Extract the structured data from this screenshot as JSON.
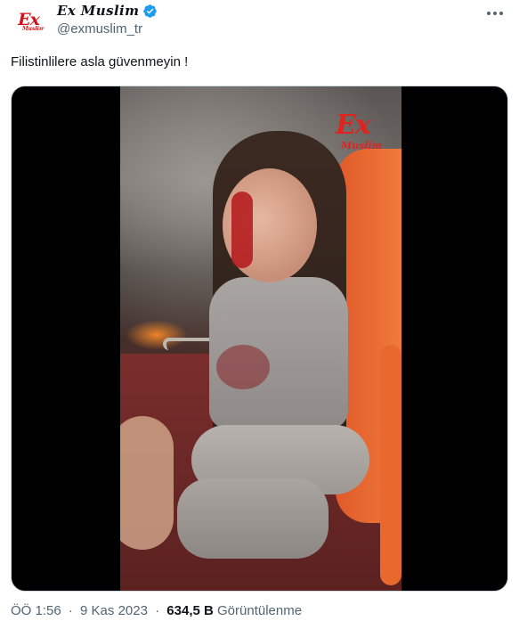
{
  "author": {
    "display_name": "Ex Muslim",
    "handle": "@exmuslim_tr",
    "avatar_logo_text": "Ex",
    "avatar_logo_sub": "Muslim",
    "verified": true
  },
  "tweet": {
    "text": "Filistinlilere asla güvenmeyin !"
  },
  "media": {
    "type": "video",
    "watermark_ex": "Ex",
    "watermark_muslim": "Muslim"
  },
  "meta": {
    "time": "ÖÖ 1:56",
    "separator": "·",
    "date": "9 Kas 2023",
    "views_count": "634,5 B",
    "views_label": "Görüntülenme"
  },
  "colors": {
    "brand_red": "#d0141b",
    "verified_blue": "#1d9bf0",
    "text_primary": "#0f1419",
    "text_secondary": "#536471"
  },
  "icons": {
    "verified": "verified-badge-icon",
    "more": "more-options-icon"
  }
}
